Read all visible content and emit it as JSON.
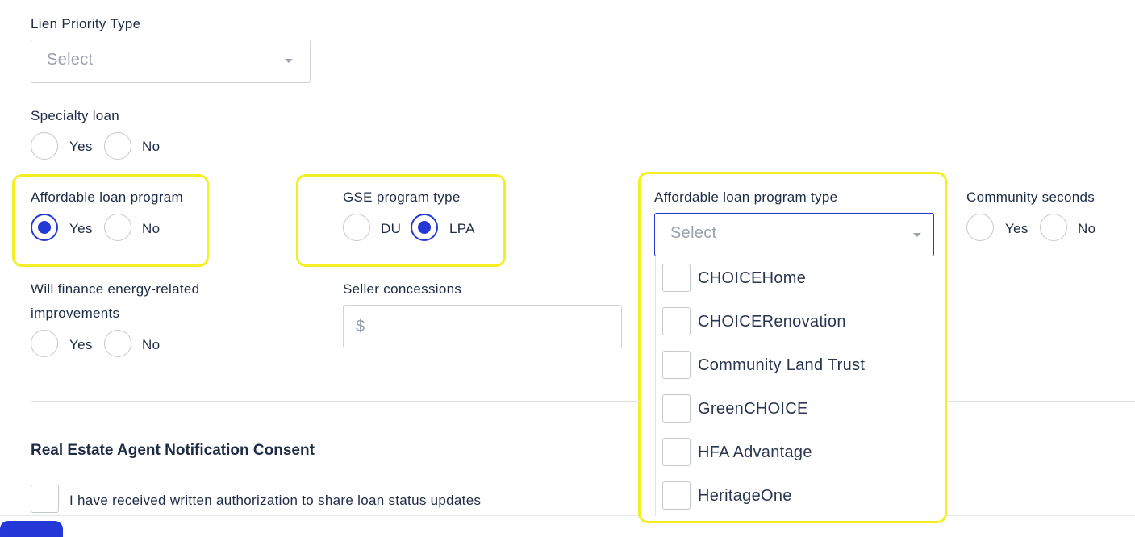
{
  "lien_priority": {
    "label": "Lien Priority Type",
    "placeholder": "Select"
  },
  "specialty_loan": {
    "label": "Specialty loan",
    "yes": "Yes",
    "no": "No",
    "selected": ""
  },
  "affordable_loan_program": {
    "label": "Affordable loan program",
    "yes": "Yes",
    "no": "No",
    "selected": "Yes"
  },
  "gse_program_type": {
    "label": "GSE program type",
    "du": "DU",
    "lpa": "LPA",
    "selected": "LPA"
  },
  "affordable_loan_program_type": {
    "label": "Affordable loan program type",
    "placeholder": "Select",
    "options": [
      "CHOICEHome",
      "CHOICERenovation",
      "Community Land Trust",
      "GreenCHOICE",
      "HFA Advantage",
      "HeritageOne"
    ]
  },
  "community_seconds": {
    "label": "Community seconds",
    "yes": "Yes",
    "no": "No",
    "selected": ""
  },
  "energy_improvements": {
    "label_line1": "Will finance energy-related",
    "label_line2": "improvements",
    "yes": "Yes",
    "no": "No",
    "selected": ""
  },
  "seller_concessions": {
    "label": "Seller concessions",
    "prefix": "$",
    "value": ""
  },
  "agent_consent": {
    "heading": "Real Estate Agent Notification Consent",
    "checkbox_label": "I have received written authorization to share loan status updates"
  },
  "colors": {
    "accent": "#2338d6",
    "highlight": "#f4ef25"
  }
}
